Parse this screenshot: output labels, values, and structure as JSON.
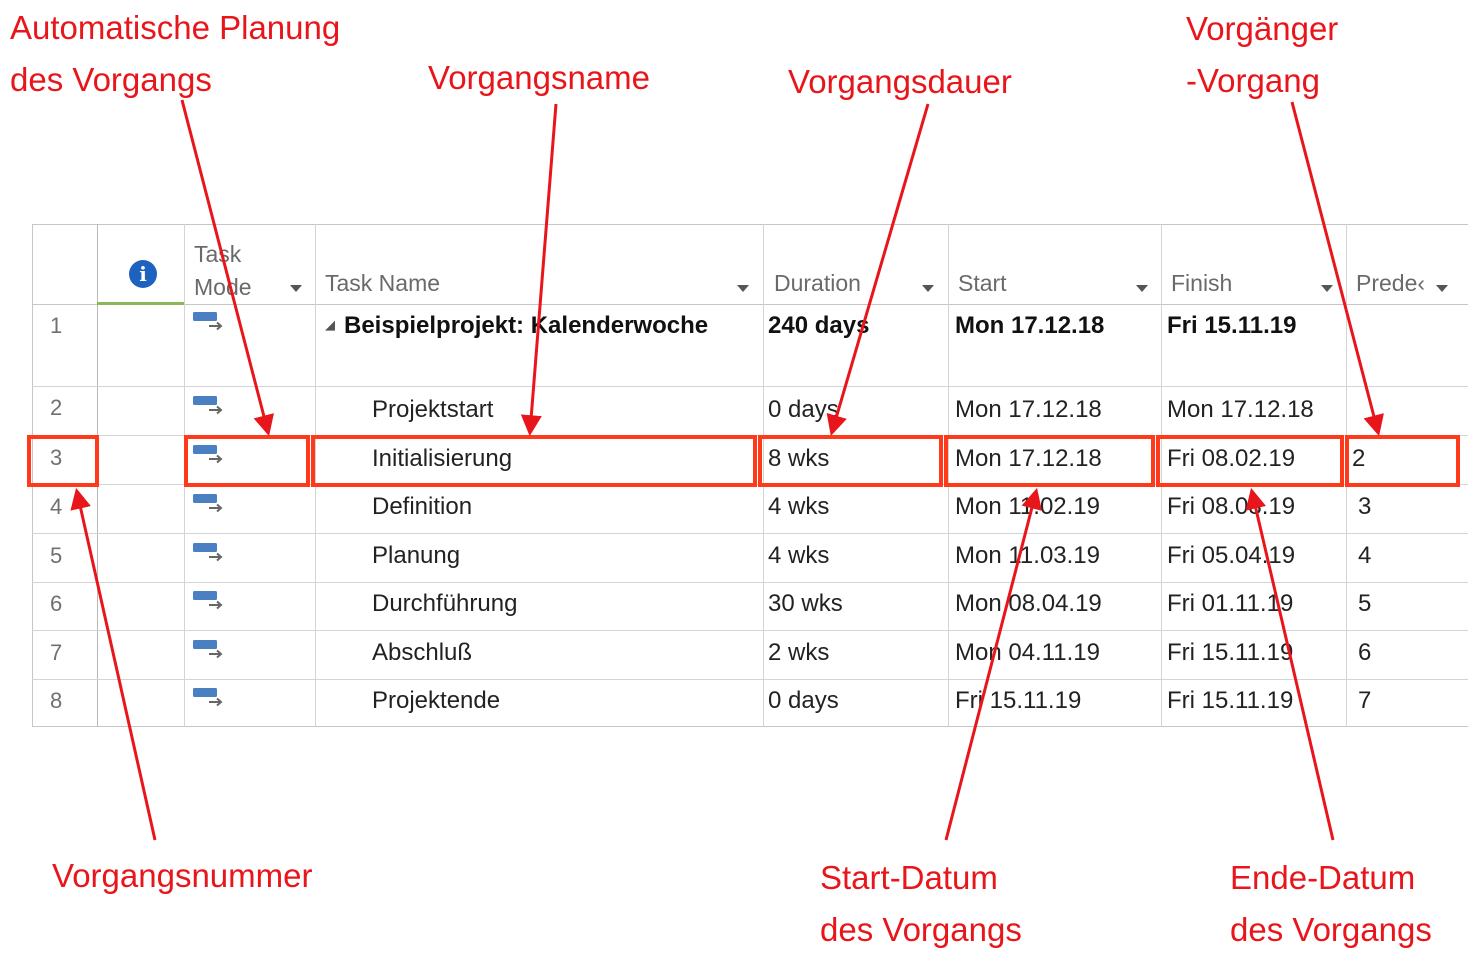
{
  "annotations": {
    "auto_planning": [
      "Automatische Planung",
      "des Vorgangs"
    ],
    "task_name": [
      "Vorgangsname"
    ],
    "duration": [
      "Vorgangsdauer"
    ],
    "predecessor": [
      "Vorgänger",
      "-Vorgang"
    ],
    "task_number": [
      "Vorgangsnummer"
    ],
    "start_date": [
      "Start-Datum",
      "des Vorgangs"
    ],
    "end_date": [
      "Ende-Datum",
      "des Vorgangs"
    ]
  },
  "columns": {
    "info_icon": "i",
    "task_mode": [
      "Task",
      "Mode"
    ],
    "task_name": "Task Name",
    "duration": "Duration",
    "start": "Start",
    "finish": "Finish",
    "predecessors": "Prede‹"
  },
  "rows": [
    {
      "id": "1",
      "name": "Beispielprojekt: Kalenderwoche",
      "duration": "240 days",
      "start": "Mon 17.12.18",
      "finish": "Fri 15.11.19",
      "pred": "",
      "summary": true
    },
    {
      "id": "2",
      "name": "Projektstart",
      "duration": "0 days",
      "start": "Mon 17.12.18",
      "finish": "Mon 17.12.18",
      "pred": ""
    },
    {
      "id": "3",
      "name": "Initialisierung",
      "duration": "8 wks",
      "start": "Mon 17.12.18",
      "finish": "Fri 08.02.19",
      "pred": "2"
    },
    {
      "id": "4",
      "name": "Definition",
      "duration": "4 wks",
      "start": "Mon 11.02.19",
      "finish": "Fri 08.03.19",
      "pred": "3"
    },
    {
      "id": "5",
      "name": "Planung",
      "duration": "4 wks",
      "start": "Mon 11.03.19",
      "finish": "Fri 05.04.19",
      "pred": "4"
    },
    {
      "id": "6",
      "name": "Durchführung",
      "duration": "30 wks",
      "start": "Mon 08.04.19",
      "finish": "Fri 01.11.19",
      "pred": "5"
    },
    {
      "id": "7",
      "name": "Abschluß",
      "duration": "2 wks",
      "start": "Mon 04.11.19",
      "finish": "Fri 15.11.19",
      "pred": "6"
    },
    {
      "id": "8",
      "name": "Projektende",
      "duration": "0 days",
      "start": "Fri 15.11.19",
      "finish": "Fri 15.11.19",
      "pred": "7"
    }
  ],
  "colors": {
    "annotation": "#e8161b",
    "highlight": "#ff3a1a",
    "task_icon": "#4a7fc1"
  },
  "icons": {
    "task_mode": "auto-scheduled-task-icon",
    "info": "info-icon",
    "collapse": "collapse-triangle-icon"
  }
}
